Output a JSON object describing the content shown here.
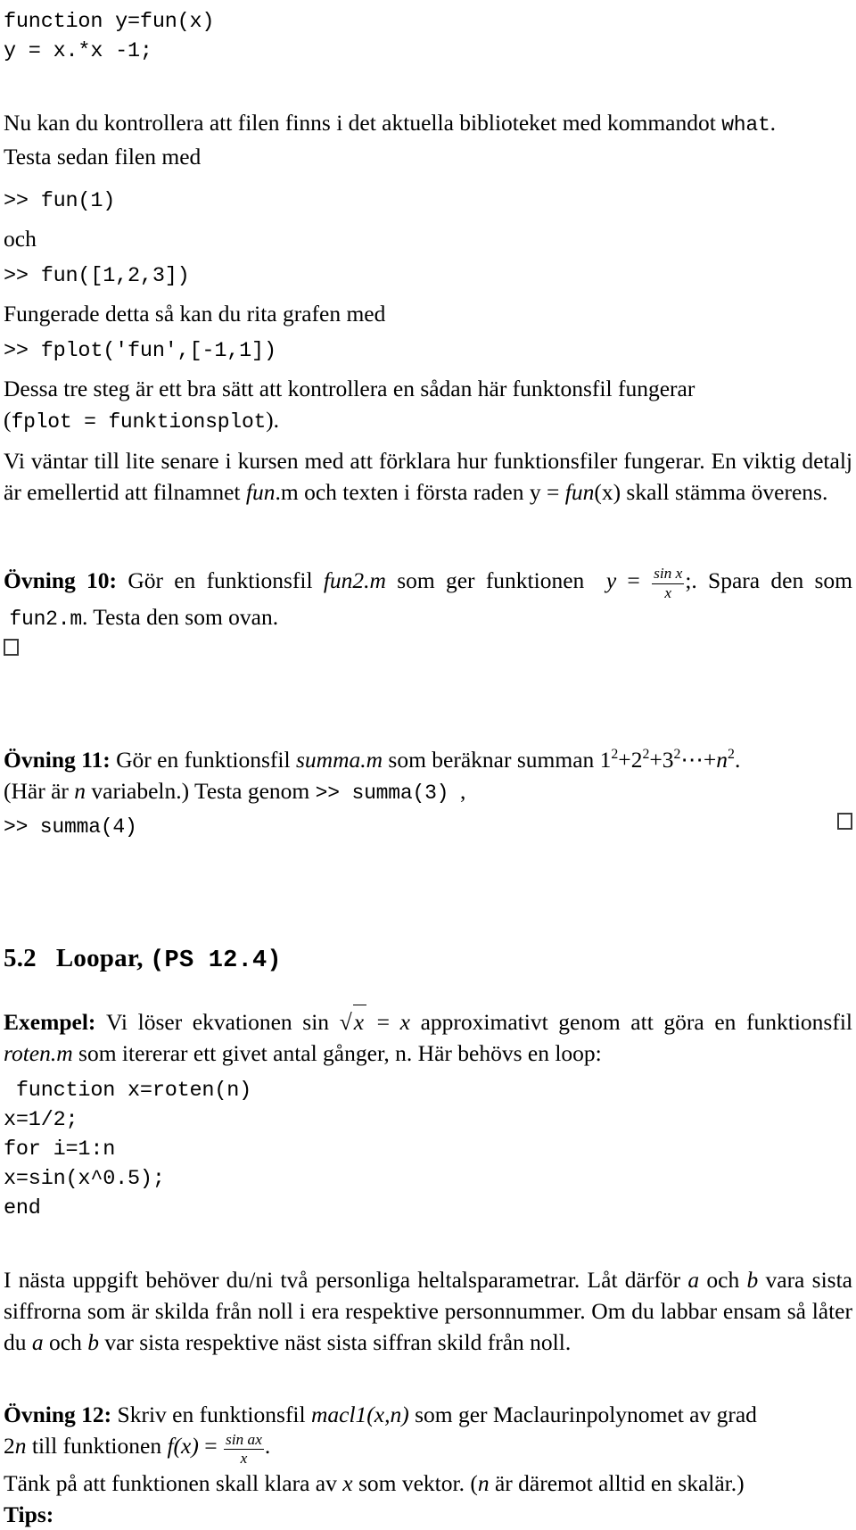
{
  "document": {
    "language": "sv",
    "kind": "matlab-lab-handout",
    "text_color": "#000000",
    "background_color": "#ffffff"
  },
  "code_top": {
    "line1": "function y=fun(x)",
    "line2": "y = x.*x -1;"
  },
  "paragraph_what": {
    "part1": "Nu kan du kontrollera att filen finns i det aktuella biblioteket med kommandot ",
    "command": "what",
    "part2": ".",
    "line2": "Testa sedan filen med"
  },
  "prompt_fun1": ">> fun(1)",
  "word_och": "och",
  "prompt_fun123": ">> fun([1,2,3])",
  "paragraph_grafen": "Fungerade detta så kan du rita grafen med",
  "prompt_fplot": ">> fplot('fun',[-1,1])",
  "paragraph_dessa": {
    "line1": "Dessa tre steg är ett bra sätt att kontrollera en sådan här funktonsfil fungerar",
    "line2_open": "(",
    "line2_code": "fplot = funktionsplot",
    "line2_close": ")."
  },
  "paragraph_vivantar": {
    "part1": "Vi väntar till lite senare i kursen med att förklara hur funktionsfiler fungerar. En viktig detalj är emellertid att filnamnet ",
    "fun_italic": "fun",
    "part2": ".m och texten i första raden y = ",
    "fun_italic2": "fun",
    "part3": "(x) skall stämma överens."
  },
  "ovning10": {
    "label": "Övning 10:",
    "text1": "Gör en funktionsfil ",
    "filename_italic": "fun2.m",
    "text2": " som ger funktionen",
    "formula": {
      "lhs": "y",
      "eq": "=",
      "numerator": "sin x",
      "denominator": "x",
      "suffix": ";."
    },
    "text3": " Spara den som ",
    "filename_mono": "fun2.m",
    "text4": ". Testa den som ovan.",
    "end_marker": "qed-box"
  },
  "ovning11": {
    "label": "Övning 11:",
    "text1": "Gör en funktionsfil ",
    "filename_italic": "summa.m",
    "text2": " som beräknar summan ",
    "sum_expr": {
      "terms": [
        "1",
        "2",
        "3"
      ],
      "exponent": "2",
      "dots": "⋯",
      "last_base": "n",
      "last_exponent": "2",
      "period": "."
    },
    "text3_open": "(Här är ",
    "var_n": "n",
    "text3_close": " variabeln.) Testa genom ",
    "call1": ">> summa(3)",
    "comma": ",",
    "call2": ">> summa(4)",
    "end_marker": "qed-box"
  },
  "section": {
    "number": "5.2",
    "title": "Loopar,",
    "reference": "(PS 12.4)"
  },
  "exempel": {
    "label": "Exempel:",
    "text1": "Vi löser ekvationen sin ",
    "sqrt_arg": "x",
    "eq": "=",
    "rhs": "x",
    "text2": " approximativt genom att göra en funktionsfil ",
    "filename_italic": "roten.m",
    "text3": " som itererar ett givet antal gånger, n. Här behövs en loop:"
  },
  "code_roten": {
    "lines": [
      " function x=roten(n)",
      "x=1/2;",
      "for i=1:n",
      "x=sin(x^0.5);",
      "end"
    ]
  },
  "paragraph_param": {
    "part1": "I nästa uppgift behöver du/ni två personliga heltalsparametrar. Låt därför ",
    "a1": "a",
    "part2": " och ",
    "b1": "b",
    "part3": " vara sista siffrorna som är skilda från noll i era respektive personnummer. Om du labbar ensam så låter du ",
    "a2": "a",
    "part4": " och ",
    "b2": "b",
    "part5": " var sista respektive näst sista siffran skild från noll."
  },
  "ovning12": {
    "label": "Övning 12:",
    "text1": "Skriv en funktionsfil ",
    "filename_italic": "macl1(x,n)",
    "text2": " som ger Maclaurinpolynomet av grad ",
    "degree": "2n",
    "text3": " till funktionen ",
    "formula": {
      "fx": "f(x)",
      "eq": "=",
      "numerator": "sin ax",
      "denominator": "x",
      "suffix": "."
    },
    "line2_part1": "Tänk på att funktionen skall klara av ",
    "var_x": "x",
    "line2_part2": " som vektor. (",
    "var_n": "n",
    "line2_part3": " är däremot alltid en skalär.)",
    "tips_label": "Tips:"
  }
}
